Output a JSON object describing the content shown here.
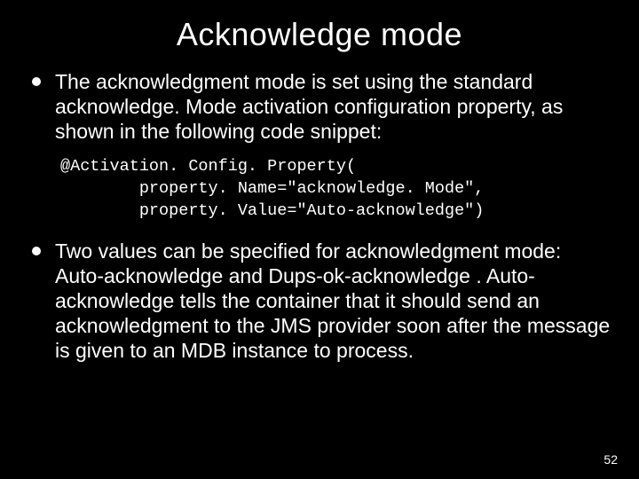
{
  "title": "Acknowledge mode",
  "bullet1": "The acknowledgment mode is set using the standard acknowledge. Mode activation configuration property, as shown in the following code snippet:",
  "code": {
    "l1": "@Activation. Config. Property(",
    "l2": "        property. Name=\"acknowledge. Mode\",",
    "l3": "        property. Value=\"Auto-acknowledge\")"
  },
  "bullet2": "Two values can be specified for acknowledgment mode: Auto-acknowledge and Dups-ok-acknowledge . Auto-acknowledge tells the container that it should send an acknowledgment to the JMS provider soon after the message is given to an MDB instance to process.",
  "page": "52"
}
